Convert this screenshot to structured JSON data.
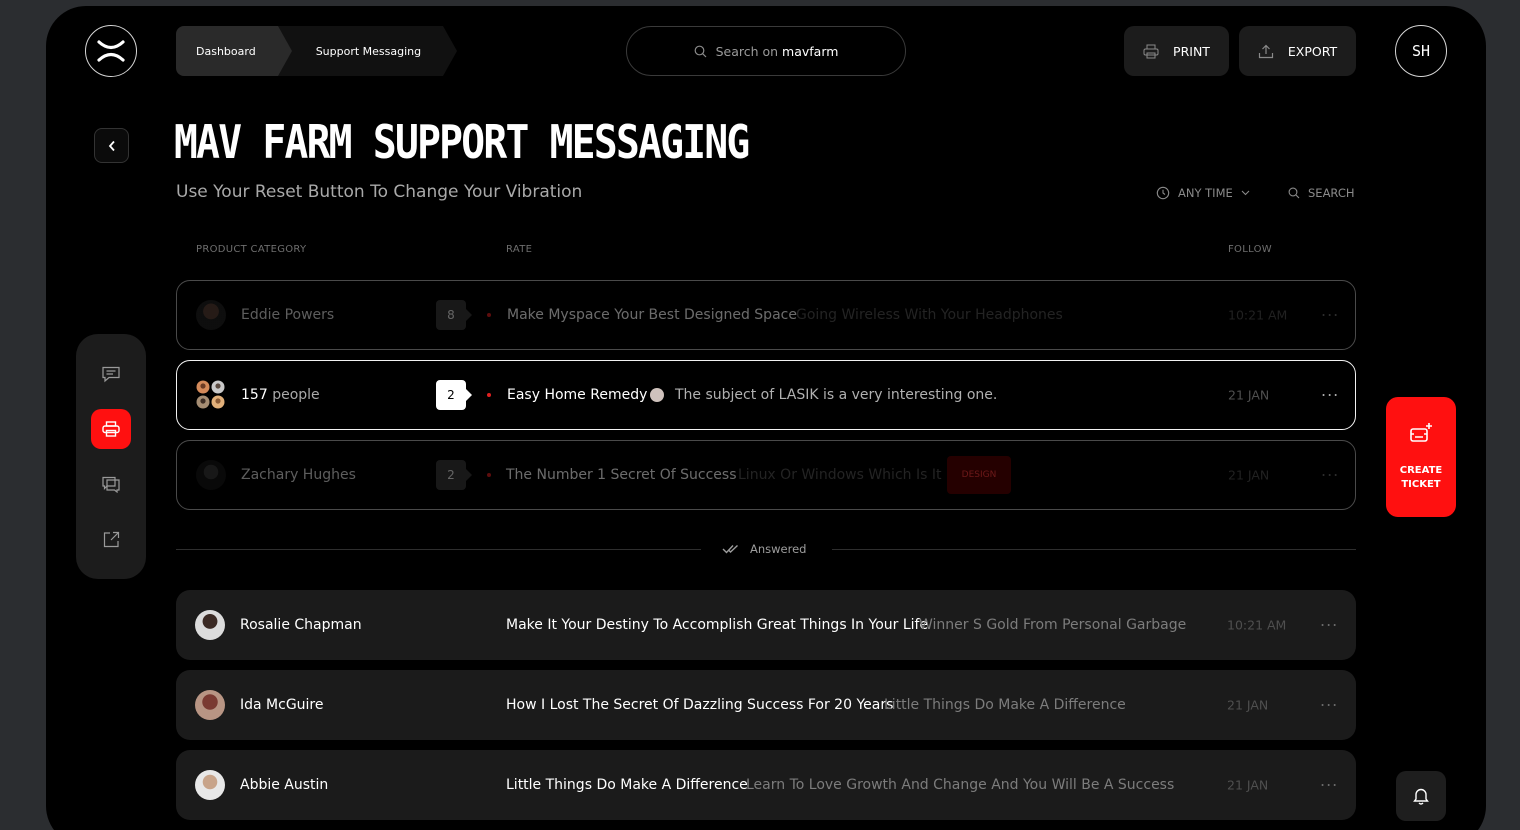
{
  "header": {
    "breadcrumb": [
      "Dashboard",
      "Support Messaging"
    ],
    "search_prefix": "Search on",
    "search_brand": "mavfarm",
    "print_label": "PRINT",
    "export_label": "EXPORT",
    "user_initials": "SH"
  },
  "page": {
    "title": "MAV FARM SUPPORT MESSAGING",
    "subtitle": "Use Your Reset Button To Change Your Vibration",
    "filter_time": "ANY TIME",
    "filter_search": "SEARCH"
  },
  "columns": {
    "category": "PRODUCT CATEGORY",
    "rate": "RATE",
    "follow": "FOLLOW"
  },
  "open_tickets": [
    {
      "name": "Eddie Powers",
      "badge": "8",
      "subject": "Make Myspace Your Best Designed Space",
      "preview": "Going Wireless With Your Headphones",
      "time": "10:21 AM"
    },
    {
      "count": "157",
      "count_label": "people",
      "badge": "2",
      "subject": "Easy Home Remedy",
      "preview": "The subject of LASIK is a very interesting one.",
      "time": "21 JAN"
    },
    {
      "name": "Zachary Hughes",
      "badge": "2",
      "subject": "The Number 1 Secret Of Success",
      "preview": "Linux Or Windows Which Is It",
      "tag": "DESIGN",
      "time": "21 JAN"
    }
  ],
  "answered_label": "Answered",
  "answered_tickets": [
    {
      "name": "Rosalie Chapman",
      "subject": "Make It Your Destiny To Accomplish Great Things In Your Life",
      "preview": "Winner S Gold From Personal Garbage",
      "time": "10:21 AM"
    },
    {
      "name": "Ida McGuire",
      "subject": "How I Lost The Secret Of Dazzling Success For 20 Years",
      "preview": "Little Things Do Make A Difference",
      "time": "21 JAN"
    },
    {
      "name": "Abbie Austin",
      "subject": "Little Things Do Make A Difference",
      "preview": "Learn To Love Growth And Change And You Will Be A Success",
      "time": "21 JAN"
    }
  ],
  "more_glyph": "···",
  "create_ticket_label": "CREATE TICKET",
  "colors": {
    "accent": "#ff1010",
    "background": "#000000",
    "row": "#1b1b1b"
  },
  "icons": [
    "logo-icon",
    "search-icon",
    "print-icon",
    "export-icon",
    "back-icon",
    "clock-icon",
    "chevron-down-icon",
    "chat-icon",
    "printer-icon",
    "messages-icon",
    "external-link-icon",
    "double-check-icon",
    "ticket-icon",
    "bell-icon"
  ]
}
